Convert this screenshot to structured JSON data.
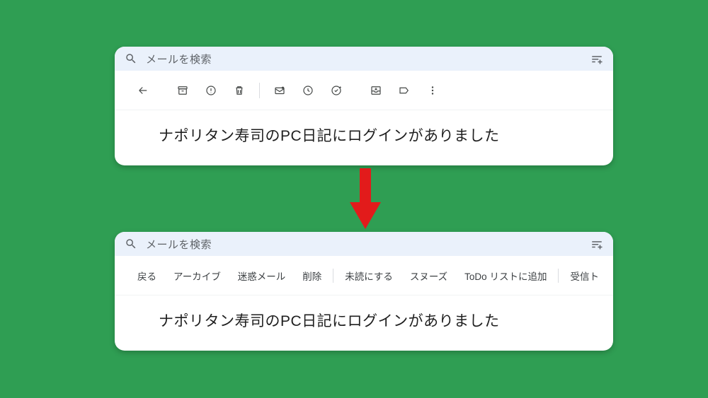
{
  "search": {
    "placeholder": "メールを検索"
  },
  "subject": "ナポリタン寿司のPC日記にログインがありました",
  "text_toolbar": {
    "back": "戻る",
    "archive": "アーカイブ",
    "spam": "迷惑メール",
    "delete": "削除",
    "unread": "未読にする",
    "snooze": "スヌーズ",
    "todo": "ToDo リストに追加",
    "inbox": "受信ト"
  },
  "icons": {
    "search": "search-icon",
    "tune": "tune-icon",
    "back": "back-arrow-icon",
    "archive": "archive-icon",
    "spam": "report-spam-icon",
    "delete": "delete-icon",
    "unread": "mark-unread-icon",
    "snooze": "snooze-icon",
    "task": "add-task-icon",
    "move": "move-to-inbox-icon",
    "label": "labels-icon",
    "more": "more-icon"
  }
}
